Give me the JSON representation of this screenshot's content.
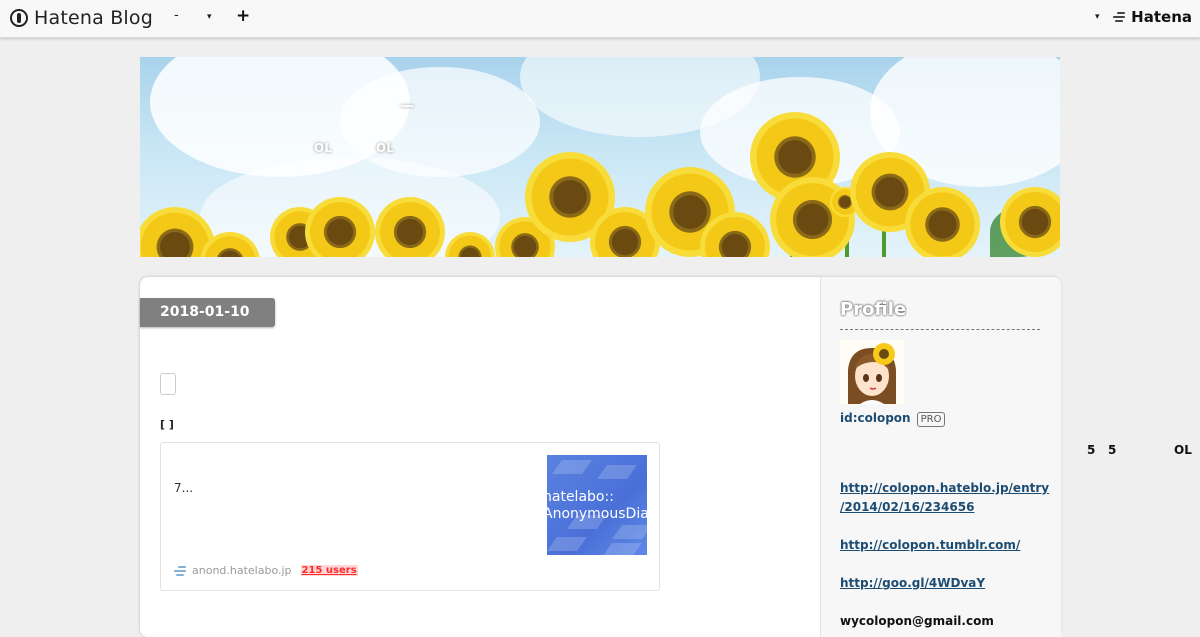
{
  "topbar": {
    "logo_text": "Hatena Blog",
    "menu_dash": "-",
    "caret": "▾",
    "plus": "+",
    "right_caret": "▾",
    "hatena_text": "Hatena"
  },
  "banner": {
    "dash": "—",
    "ol_left": "OL",
    "ol_right": "OL"
  },
  "entry": {
    "date": "2018-01-10",
    "bracket_text": "[            ]",
    "card": {
      "excerpt": "7...",
      "thumb_line1": "hatelabo::",
      "thumb_line2": "AnonymousDiary",
      "domain": "anond.hatelabo.jp",
      "users": "215 users"
    }
  },
  "sidebar": {
    "title": "Profile",
    "profile_id": "id:colopon",
    "pro": "PRO",
    "links": [
      {
        "line1": "http://colopon.hateblo.jp/entry",
        "line2": "/2014/02/16/234656"
      },
      {
        "line1": "http://colopon.tumblr.com/",
        "line2": ""
      },
      {
        "line1": "http://goo.gl/4WDvaY",
        "line2": ""
      }
    ],
    "email": "wycolopon@gmail.com"
  },
  "overflow": {
    "five_a": "5",
    "five_b": "5",
    "ol": "OL"
  },
  "colors": {
    "topbar_bg": "#f8f8f8",
    "page_bg": "#efefef",
    "date_bg": "#808080",
    "link": "#1d4c73",
    "users_red": "#ff2a2a",
    "thumb_blue": "#4a70d8"
  }
}
